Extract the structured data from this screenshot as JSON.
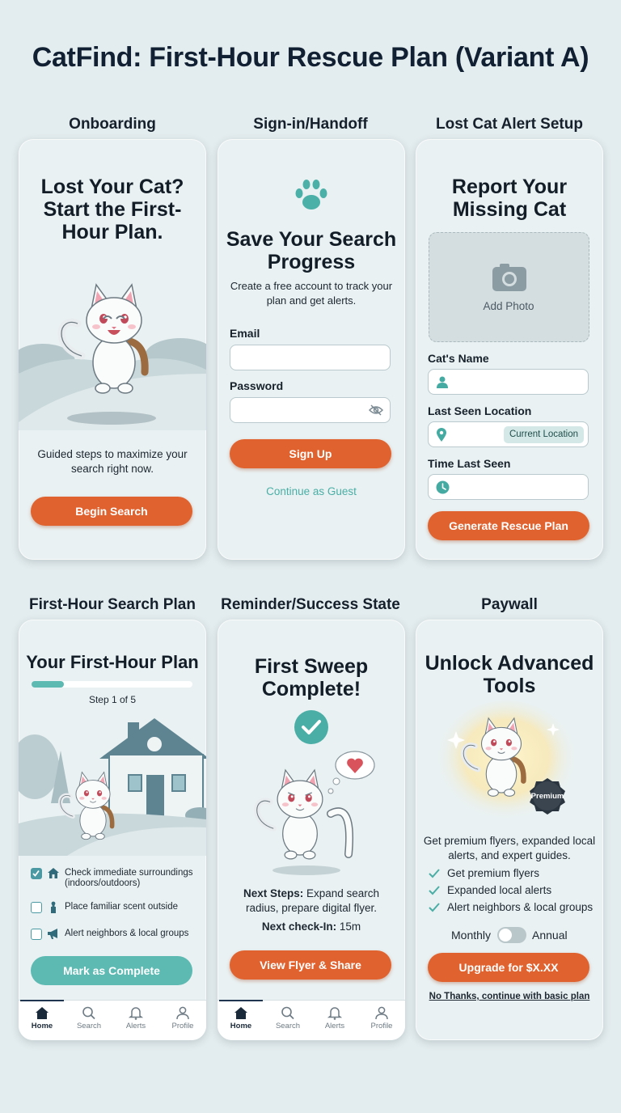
{
  "page_title": "CatFind: First-Hour Rescue Plan (Variant A)",
  "colors": {
    "accent_orange": "#e0622f",
    "accent_teal": "#5cbab3",
    "background": "#e3ecee"
  },
  "screens": {
    "onboarding": {
      "label": "Onboarding",
      "heading": "Lost Your Cat? Start the First-Hour Plan.",
      "description": "Guided steps to maximize your search right now.",
      "cta": "Begin Search"
    },
    "signin": {
      "label": "Sign-in/Handoff",
      "icon": "paw-icon",
      "heading": "Save Your Search Progress",
      "description": "Create a free account to track your plan and get alerts.",
      "email_label": "Email",
      "password_label": "Password",
      "signup_button": "Sign Up",
      "guest_link": "Continue as Guest"
    },
    "alert_setup": {
      "label": "Lost Cat Alert Setup",
      "heading": "Report Your Missing Cat",
      "add_photo": "Add Photo",
      "name_label": "Cat's Name",
      "location_label": "Last Seen Location",
      "current_location": "Current Location",
      "time_label": "Time Last Seen",
      "cta": "Generate Rescue Plan"
    },
    "plan": {
      "label": "First-Hour Search Plan",
      "heading": "Your First-Hour Plan",
      "progress": 0.2,
      "step_text": "Step 1 of 5",
      "checklist": [
        {
          "text": "Check immediate surroundings (indoors/outdoors)",
          "checked": true,
          "icon": "house-icon"
        },
        {
          "text": "Place familiar scent outside",
          "checked": false,
          "icon": "scent-icon"
        },
        {
          "text": "Alert neighbors & local groups",
          "checked": false,
          "icon": "megaphone-icon"
        }
      ],
      "cta": "Mark as Complete"
    },
    "success": {
      "label": "Reminder/Success State",
      "heading": "First Sweep Complete!",
      "next_steps_label": "Next Steps:",
      "next_steps_text": " Expand search radius, prepare digital flyer.",
      "checkin_label": "Next check-In:",
      "checkin_value": " 15m",
      "cta": "View Flyer & Share"
    },
    "paywall": {
      "label": "Paywall",
      "heading": "Unlock Advanced Tools",
      "badge": "Premium",
      "description": "Get premium flyers, expanded local alerts, and expert guides.",
      "features": [
        "Get premium flyers",
        "Expanded local alerts",
        "Alert neighbors & local groups"
      ],
      "toggle_monthly": "Monthly",
      "toggle_annual": "Annual",
      "cta": "Upgrade for $X.XX",
      "decline": "No Thanks, continue with basic plan"
    }
  },
  "tabbar": [
    {
      "label": "Home",
      "icon": "home-icon",
      "active": true
    },
    {
      "label": "Search",
      "icon": "search-icon",
      "active": false
    },
    {
      "label": "Alerts",
      "icon": "bell-icon",
      "active": false
    },
    {
      "label": "Profile",
      "icon": "profile-icon",
      "active": false
    }
  ]
}
